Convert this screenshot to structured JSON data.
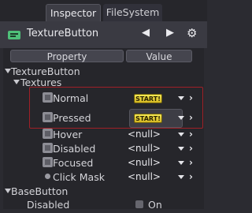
{
  "tabs": [
    {
      "label": "Inspector",
      "active": true
    },
    {
      "label": "FileSystem",
      "active": false
    }
  ],
  "header": {
    "resource_name": "TextureButton",
    "resource_icon": "texture-button-icon",
    "prev_icon": "◀",
    "next_icon": "▶",
    "settings_icon": "⚙"
  },
  "columns": {
    "property": "Property",
    "value": "Value"
  },
  "sections": {
    "texture_button": "TextureButton",
    "textures": "Textures",
    "base_button": "BaseButton"
  },
  "properties": {
    "normal": {
      "label": "Normal",
      "badge": "START!"
    },
    "pressed": {
      "label": "Pressed",
      "badge": "START!"
    },
    "hover": {
      "label": "Hover",
      "value": "<null>"
    },
    "disabled": {
      "label": "Disabled",
      "value": "<null>"
    },
    "focused": {
      "label": "Focused",
      "value": "<null>"
    },
    "click_mask": {
      "label": "Click Mask",
      "value": "<null>"
    },
    "base_disabled": {
      "label": "Disabled",
      "value": "On"
    }
  },
  "colors": {
    "background": "#2b2b31",
    "header": "#3a3a42",
    "highlight_border": "#a02027",
    "badge": "#e8d43a",
    "resource_icon": "#4fc079"
  },
  "glyphs": {
    "chevron_right": "›"
  }
}
